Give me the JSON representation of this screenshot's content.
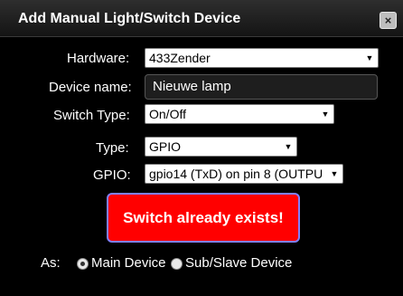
{
  "dialog": {
    "title": "Add Manual Light/Switch Device",
    "close_glyph": "×"
  },
  "form": {
    "hardware": {
      "label": "Hardware:",
      "value": "433Zender"
    },
    "device_name": {
      "label": "Device name:",
      "value": "Nieuwe lamp"
    },
    "switch_type": {
      "label": "Switch Type:",
      "value": "On/Off"
    },
    "type": {
      "label": "Type:",
      "value": "GPIO"
    },
    "gpio": {
      "label": "GPIO:",
      "value": "gpio14 (TxD) on pin 8 (OUTPU"
    }
  },
  "alert": {
    "message": "Switch already exists!",
    "background": "#ff0000"
  },
  "as": {
    "label": "As:",
    "options": [
      {
        "label": "Main Device",
        "checked": true
      },
      {
        "label": "Sub/Slave Device",
        "checked": false
      }
    ]
  },
  "icons": {
    "dropdown": "chevron-down-icon",
    "close": "close-icon"
  }
}
